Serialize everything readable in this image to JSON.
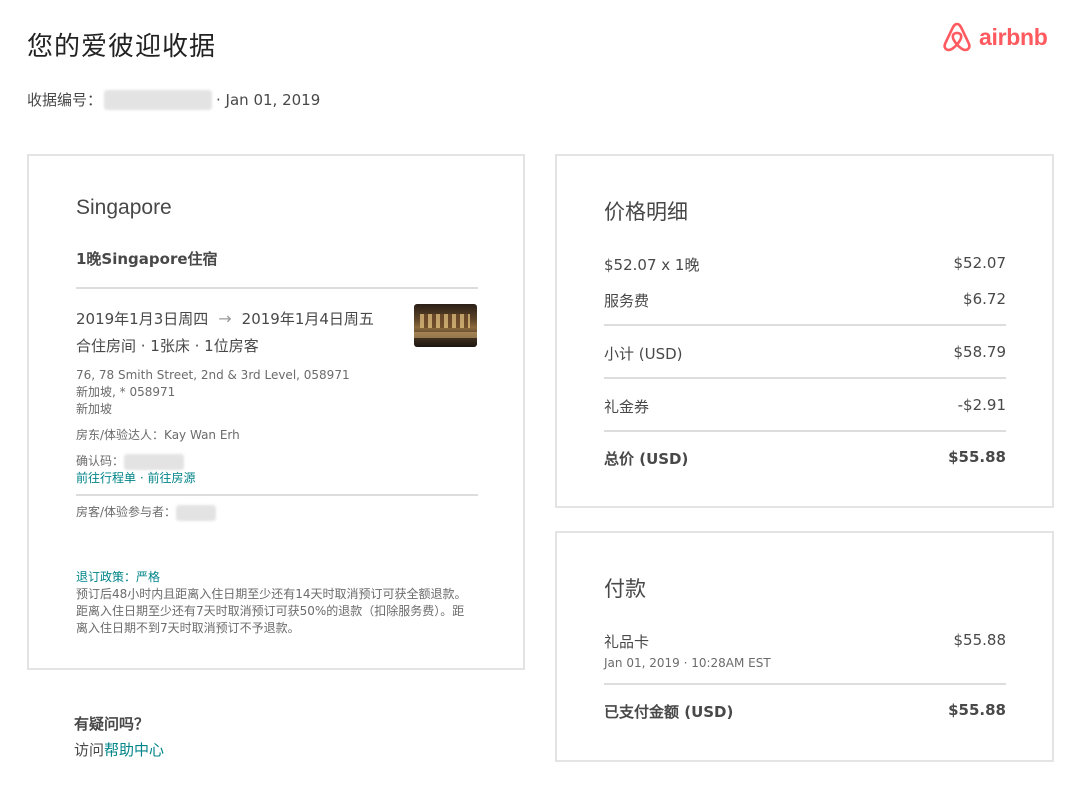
{
  "header": {
    "title": "您的爱彼迎收据",
    "logo_text": "airbnb",
    "receipt_label": "收据编号：",
    "receipt_date": "· Jan 01, 2019"
  },
  "trip": {
    "city": "Singapore",
    "stay_title": "1晚Singapore住宿",
    "checkin": "2019年1月3日周四",
    "arrow": "→",
    "checkout": "2019年1月4日周五",
    "room_type": "合住房间 · 1张床 · 1位房客",
    "address_line1": "76, 78 Smith Street, 2nd & 3rd Level, 058971",
    "address_line2": "新加坡, * 058971",
    "address_line3": "新加坡",
    "host_label": "房东/体验达人：",
    "host_name": "Kay Wan Erh",
    "confirm_label": "确认码：",
    "link_itinerary": "前往行程单",
    "link_sep": " · ",
    "link_listing": "前往房源",
    "guests_label": "房客/体验参与者：",
    "policy_label": "退订政策：",
    "policy_value": "严格",
    "policy_text": "预订后48小时内且距离入住日期至少还有14天时取消预订可获全额退款。距离入住日期至少还有7天时取消预订可获50%的退款（扣除服务费）。距离入住日期不到7天时取消预订不予退款。"
  },
  "help": {
    "title": "有疑问吗？",
    "prefix": "访问",
    "link": "帮助中心"
  },
  "price": {
    "title": "价格明细",
    "rows": [
      {
        "label": "$52.07 x 1晚",
        "amount": "$52.07"
      },
      {
        "label": "服务费",
        "amount": "$6.72"
      },
      {
        "label": "小计 (USD)",
        "amount": "$58.79"
      },
      {
        "label": "礼金券",
        "amount": "-$2.91"
      },
      {
        "label": "总价 (USD)",
        "amount": "$55.88"
      }
    ]
  },
  "payment": {
    "title": "付款",
    "method": "礼品卡",
    "method_amount": "$55.88",
    "method_date": "Jan 01, 2019 · 10:28AM EST",
    "paid_label": "已支付金额 (USD)",
    "paid_amount": "$55.88"
  },
  "colors": {
    "brand": "#FF5A5F",
    "link": "#008489",
    "text": "#484848"
  }
}
